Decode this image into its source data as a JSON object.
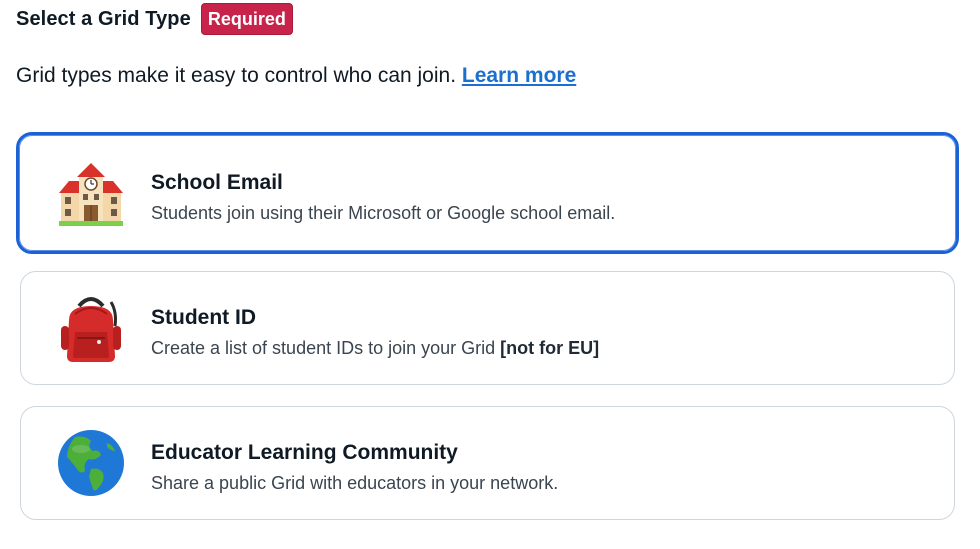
{
  "header": {
    "title": "Select a Grid Type",
    "required_badge": "Required"
  },
  "description": {
    "text": "Grid types make it easy to control who can join. ",
    "link_label": "Learn more"
  },
  "options": [
    {
      "title": "School Email",
      "subtitle": "Students join using their Microsoft or Google school email.",
      "icon": "school-building-icon",
      "selected": true
    },
    {
      "title": "Student ID",
      "subtitle": "Create a list of student IDs to join your Grid ",
      "subtitle_bold": "[not for EU]",
      "icon": "backpack-icon",
      "selected": false
    },
    {
      "title": "Educator Learning Community",
      "subtitle": "Share a public Grid with educators in your network.",
      "icon": "globe-americas-icon",
      "selected": false
    }
  ],
  "colors": {
    "accent": "#1a62d6",
    "badge": "#c8234a",
    "link": "#1a6fd0"
  }
}
